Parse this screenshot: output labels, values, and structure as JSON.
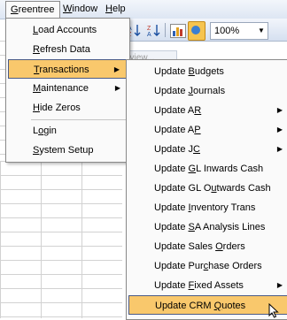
{
  "menubar": {
    "items": [
      {
        "label": "Greentree",
        "mnemonic": "G",
        "rest": "reentree"
      },
      {
        "label": "Window",
        "mnemonic": "W",
        "rest": "indow"
      },
      {
        "label": "Help",
        "mnemonic": "H",
        "rest": "elp"
      }
    ]
  },
  "toolbar": {
    "zoom_value": "100%",
    "icons": [
      "sort-ascending-icon",
      "sort-descending-icon",
      "chart-icon",
      "map-icon",
      "dropdown-arrow-icon"
    ]
  },
  "sheet": {
    "partial_tab_label": "eview..."
  },
  "greentree_menu": {
    "items": [
      {
        "before": "",
        "mnemonic": "L",
        "after": "oad Accounts",
        "has_submenu": false
      },
      {
        "before": "",
        "mnemonic": "R",
        "after": "efresh Data",
        "has_submenu": false
      },
      {
        "before": "",
        "mnemonic": "T",
        "after": "ransactions",
        "has_submenu": true,
        "selected": true
      },
      {
        "before": "",
        "mnemonic": "M",
        "after": "aintenance",
        "has_submenu": true
      },
      {
        "before": "",
        "mnemonic": "H",
        "after": "ide Zeros",
        "has_submenu": false
      },
      {
        "before": "L",
        "mnemonic": "o",
        "after": "gin",
        "has_submenu": false
      },
      {
        "before": "",
        "mnemonic": "S",
        "after": "ystem Setup",
        "has_submenu": false
      }
    ]
  },
  "transactions_menu": {
    "items": [
      {
        "before": "Update ",
        "mnemonic": "B",
        "after": "udgets",
        "has_submenu": false
      },
      {
        "before": "Update ",
        "mnemonic": "J",
        "after": "ournals",
        "has_submenu": false
      },
      {
        "before": "Update A",
        "mnemonic": "R",
        "after": "",
        "has_submenu": true
      },
      {
        "before": "Update A",
        "mnemonic": "P",
        "after": "",
        "has_submenu": true
      },
      {
        "before": "Update J",
        "mnemonic": "C",
        "after": "",
        "has_submenu": true
      },
      {
        "before": "Update ",
        "mnemonic": "G",
        "after": "L Inwards Cash",
        "has_submenu": false
      },
      {
        "before": "Update GL O",
        "mnemonic": "u",
        "after": "twards Cash",
        "has_submenu": false
      },
      {
        "before": "Update ",
        "mnemonic": "I",
        "after": "nventory Trans",
        "has_submenu": false
      },
      {
        "before": "Update ",
        "mnemonic": "S",
        "after": "A Analysis Lines",
        "has_submenu": false
      },
      {
        "before": "Update Sales ",
        "mnemonic": "O",
        "after": "rders",
        "has_submenu": false
      },
      {
        "before": "Update Pur",
        "mnemonic": "c",
        "after": "hase Orders",
        "has_submenu": false
      },
      {
        "before": "Update ",
        "mnemonic": "F",
        "after": "ixed Assets",
        "has_submenu": true
      },
      {
        "before": "Update CRM ",
        "mnemonic": "Q",
        "after": "uotes",
        "has_submenu": false,
        "selected": true
      }
    ]
  }
}
